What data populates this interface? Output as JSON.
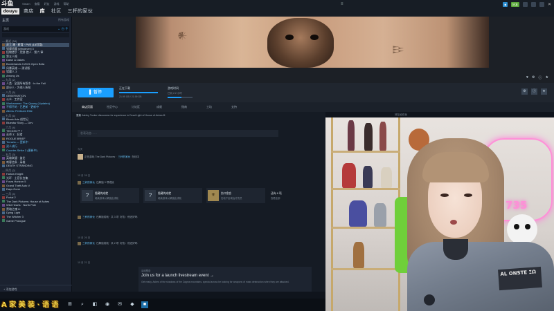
{
  "topbar": {
    "logo_top": "斗鱼",
    "logo_bottom": "douyu",
    "menu": [
      "Steam",
      "查看",
      "好友",
      "游戏",
      "帮助"
    ],
    "nav": [
      "商店",
      "库",
      "社区",
      "三杯的家伙"
    ],
    "hamburger": "≡",
    "pill_blue": "◀",
    "pill_green": "好友",
    "close": "✕"
  },
  "sidebar": {
    "title": "主页",
    "subtitle": "所有游戏",
    "filter": "游戏",
    "categories": [
      {
        "label": "— 最近 (34)",
        "items": [
          "灵工 艰 · 转弯 · PVE (15可用)",
          "猎魔猎魔 [Whatever] 3",
          "怪物猎手 · 荒野 猎人 · 第六 章",
          "第五人格",
          "Dawn & Dakes",
          "Borderlands 3 2021 Open Beta",
          "风暴英雄 — 测试版",
          "猎魔人 3",
          "Among Us"
        ]
      },
      {
        "label": "— 九月 (2)",
        "items": [
          "人类 · 全国所有版本 · In the Fall",
          "部分人 · 为他人所知"
        ]
      },
      {
        "label": "— 八月 (5)",
        "items": [
          "OBSERVATION",
          "公众 · 工作室",
          "Warhammer: The Quarry (Updates)",
          "不得不的 · 已更新 · 更新中",
          "Aliens: Fireteam Elite"
        ]
      },
      {
        "label": "— 七月 (6)",
        "items": [
          "Bionic Arts 创世记",
          "Bluestar Story — Dev"
        ]
      },
      {
        "label": "— 六月 (4)",
        "items": [
          "TEKKEN™ 7",
          "巫师 3：狂猎",
          "ROGUE BRIEF",
          "Terraria — 更新中",
          "双人成行",
          "Counter-Strike 2 (更新中)"
        ]
      },
      {
        "label": "— 五月 (3)",
        "items": [
          "英雄联盟 · 盖伦",
          "刺客信条 · 枭雄",
          "DEATH STRANDING"
        ]
      },
      {
        "label": "— 四月 (2)",
        "items": [
          "Hollow Knight",
          "光环 · 士官长合集",
          "Forza Horizon 5",
          "Grand Theft Auto V",
          "Days Gone"
        ]
      },
      {
        "label": "— 三月 (4)",
        "items": [
          "Portal 2",
          "The Dark Pictures: House of Ashes",
          "Wild Hearts · North Pole",
          "黑暗之魂 III",
          "Dying Light",
          "The Witcher 3",
          "Game Prologue"
        ]
      }
    ],
    "footer": "+ 添加游戏"
  },
  "hero": {
    "icons": [
      "♥",
      "⚙",
      "ⓘ",
      "★"
    ]
  },
  "actionbar": {
    "play_label": "▌ 暂停",
    "download_title": "正在下载",
    "download_sub": "21.99 GB / 21.99 GB",
    "download_progress": 1.0,
    "plays_title": "游戏时间",
    "plays_sub": "已玩 2.2 小时",
    "plays_progress": 0.55,
    "icons": [
      "⚙",
      "ⓘ",
      "★"
    ]
  },
  "tabs": [
    "商店页面",
    "社区中心",
    "讨论区",
    "成就",
    "指南",
    "工坊",
    "支持"
  ],
  "content": {
    "notice_lead": "更新",
    "notice_text": "Ashley Tucker discussion for experience in Dead Light of House of Ashes ⊞",
    "post_placeholder": "发表动态……",
    "date1": "今天",
    "act1": {
      "name": "三杯的家伙",
      "text": "正在游玩 The Dark Pictures ·",
      "tail": "在线中"
    },
    "date2": "10 月 28 日",
    "act2": {
      "name": "三杯的家伙",
      "text": "已解锁 3 项成就"
    },
    "achievements": [
      {
        "icon": "?",
        "title": "隐藏的成就",
        "sub": "继续游戏以解锁此成就"
      },
      {
        "icon": "?",
        "title": "隐藏的成就",
        "sub": "继续游戏以解锁此成就"
      },
      {
        "icon": "⚜",
        "title": "伤口愈合",
        "sub": "在地下区域治疗伤员"
      },
      {
        "icon": "",
        "title": "还有 8 项",
        "sub": "查看全部"
      }
    ],
    "act3": {
      "name": "三杯的家伙",
      "text": "已解锁成就 · 共 3 项",
      "tail": "好友：他还好吗"
    },
    "date3": "10 月 26 日",
    "act4": {
      "name": "三杯的家伙",
      "text": "已解锁成就 · 共 2 项",
      "tail": "好友：他还好吗"
    },
    "date4": "10 月 21 日",
    "event_label": "活动预告",
    "event_title": "Join us for a launch livestream event →",
    "event_desc": "Get ready, Ashes of the shadows of the Zagros mountains, special across be looking for weapons of mass destruction when they are attacked.",
    "fade_text": "查看更早的动态"
  },
  "rightcol": {
    "text": "好友也在玩"
  },
  "cam": {
    "led_text": "735",
    "patch_text": "AL ONSTE ΞΩ"
  },
  "taskbar": {
    "icons": [
      "⊞",
      "⌕",
      "◧",
      "◉",
      "✉",
      "◆",
      "■"
    ]
  },
  "watermark": "A 家 美 装 · 语 语"
}
